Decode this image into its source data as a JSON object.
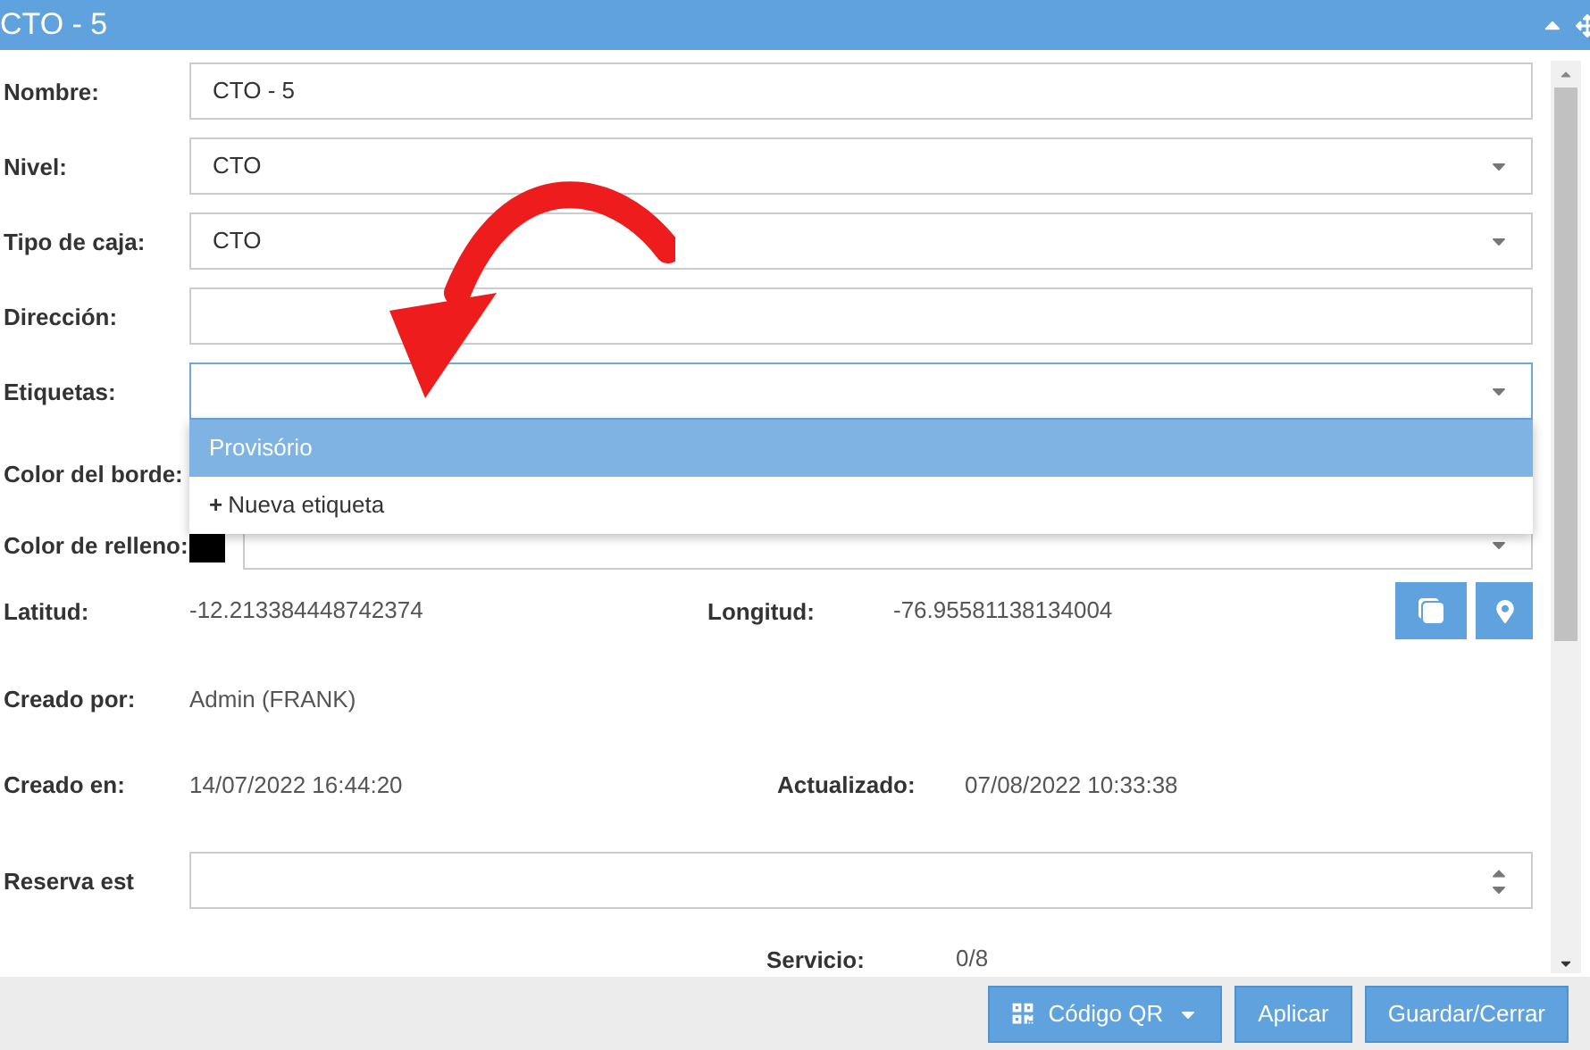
{
  "window": {
    "title": "CTO - 5"
  },
  "fields": [
    {
      "kind": "text",
      "label": "Nombre:",
      "value": "CTO - 5",
      "focused": false
    },
    {
      "kind": "select",
      "label": "Nivel:",
      "value": "CTO",
      "focused": false
    },
    {
      "kind": "select",
      "label": "Tipo de caja:",
      "value": "CTO",
      "focused": false
    },
    {
      "kind": "text",
      "label": "Dirección:",
      "focused": false
    },
    {
      "kind": "select",
      "label": "Etiquetas:",
      "focused": true,
      "options": [
        {
          "kind": "option",
          "label": "Provisório",
          "selected": true
        },
        {
          "kind": "add",
          "icon": "+",
          "label": "Nueva etiqueta",
          "selected": false
        }
      ]
    },
    {
      "kind": "covered",
      "label": "Color del borde:"
    },
    {
      "kind": "color",
      "label": "Color de relleno:",
      "color": "#000000"
    }
  ],
  "coordinates": {
    "latitude_label": "Latitud:",
    "latitude": "-12.213384448742374",
    "longitude_label": "Longitud:",
    "longitude": "-76.95581138134004"
  },
  "created_by": {
    "label": "Creado por:",
    "value": "Admin (FRANK)"
  },
  "dates": {
    "created_label": "Creado en:",
    "created": "14/07/2022 16:44:20",
    "updated_label": "Actualizado:",
    "updated": "07/08/2022 10:33:38"
  },
  "reserve": {
    "label": "Reserva est"
  },
  "service": {
    "label": "Servicio:",
    "value": "0/8"
  },
  "footer_buttons": [
    {
      "kind": "menu",
      "label": "Código QR"
    },
    {
      "kind": "plain",
      "label": "Aplicar"
    },
    {
      "kind": "plain",
      "label": "Guardar/Cerrar"
    }
  ]
}
